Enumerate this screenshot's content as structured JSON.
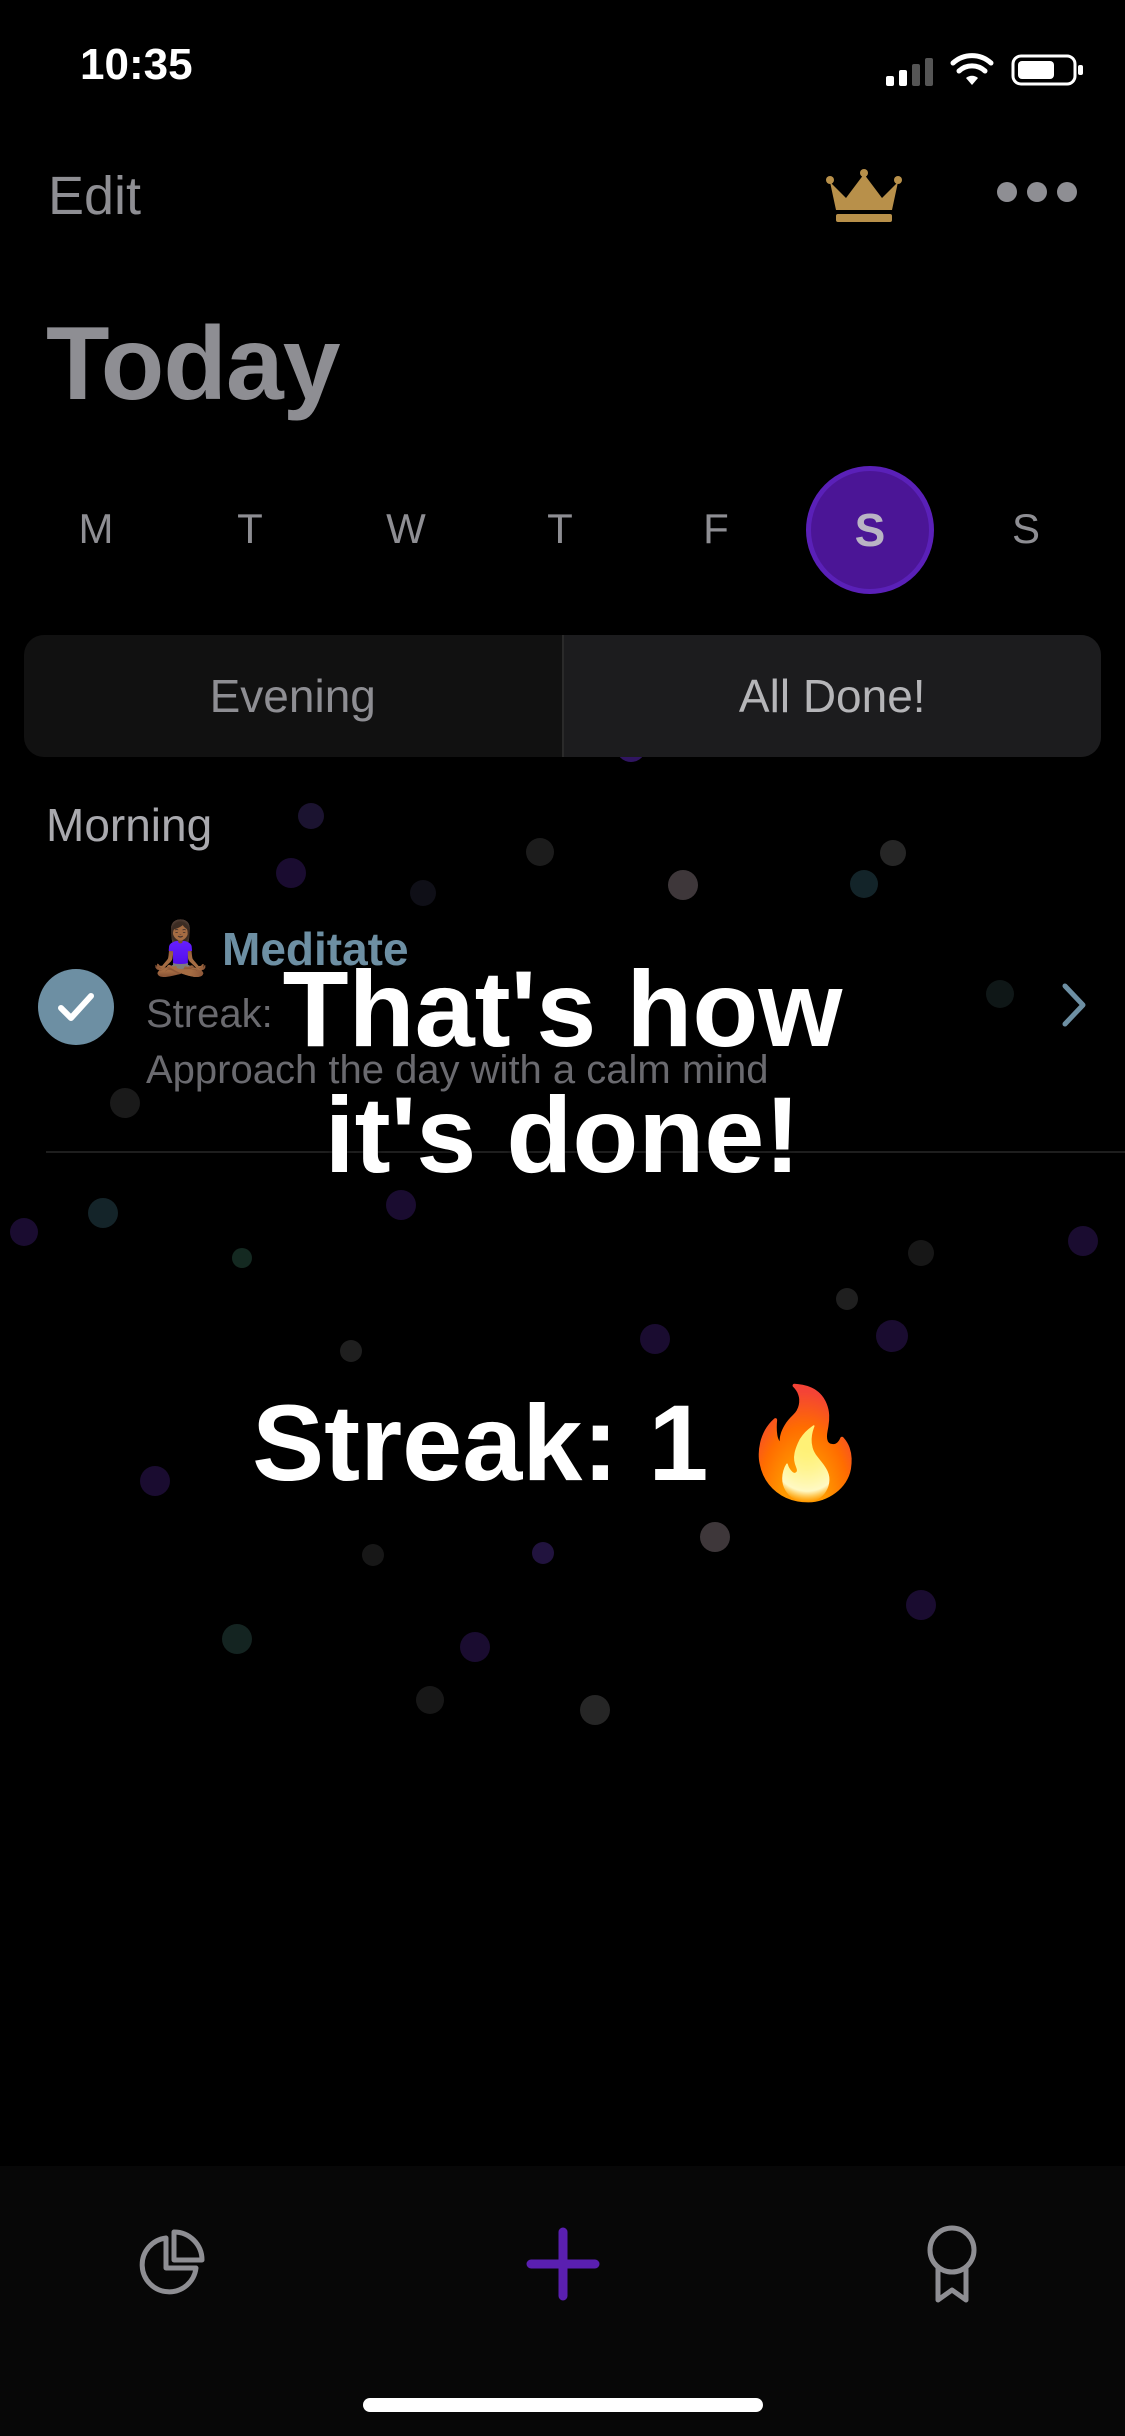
{
  "status_bar": {
    "time": "10:35"
  },
  "header": {
    "edit_label": "Edit",
    "crown_icon": "crown-icon",
    "more_icon": "more-icon"
  },
  "page_title": "Today",
  "weekdays": [
    "M",
    "T",
    "W",
    "T",
    "F",
    "S",
    "S"
  ],
  "selected_weekday_index": 5,
  "segments": [
    {
      "label": "Evening",
      "active": false
    },
    {
      "label": "All Done!",
      "active": true
    }
  ],
  "section_title": "Morning",
  "habit": {
    "emoji": "🧘🏾‍♀️",
    "name": "Meditate",
    "streak_text": "Streak:",
    "description": "Approach the day with a calm mind",
    "completed": true
  },
  "overlay": {
    "message_line1": "That's how",
    "message_line2": "it's done!",
    "streak": "Streak: 1 🔥"
  },
  "tab_bar": {
    "items": [
      "stats-icon",
      "add-icon",
      "award-icon"
    ]
  },
  "colors": {
    "accent": "#5a1fb0",
    "check": "#6d8fa3",
    "crown": "#b8904a"
  }
}
